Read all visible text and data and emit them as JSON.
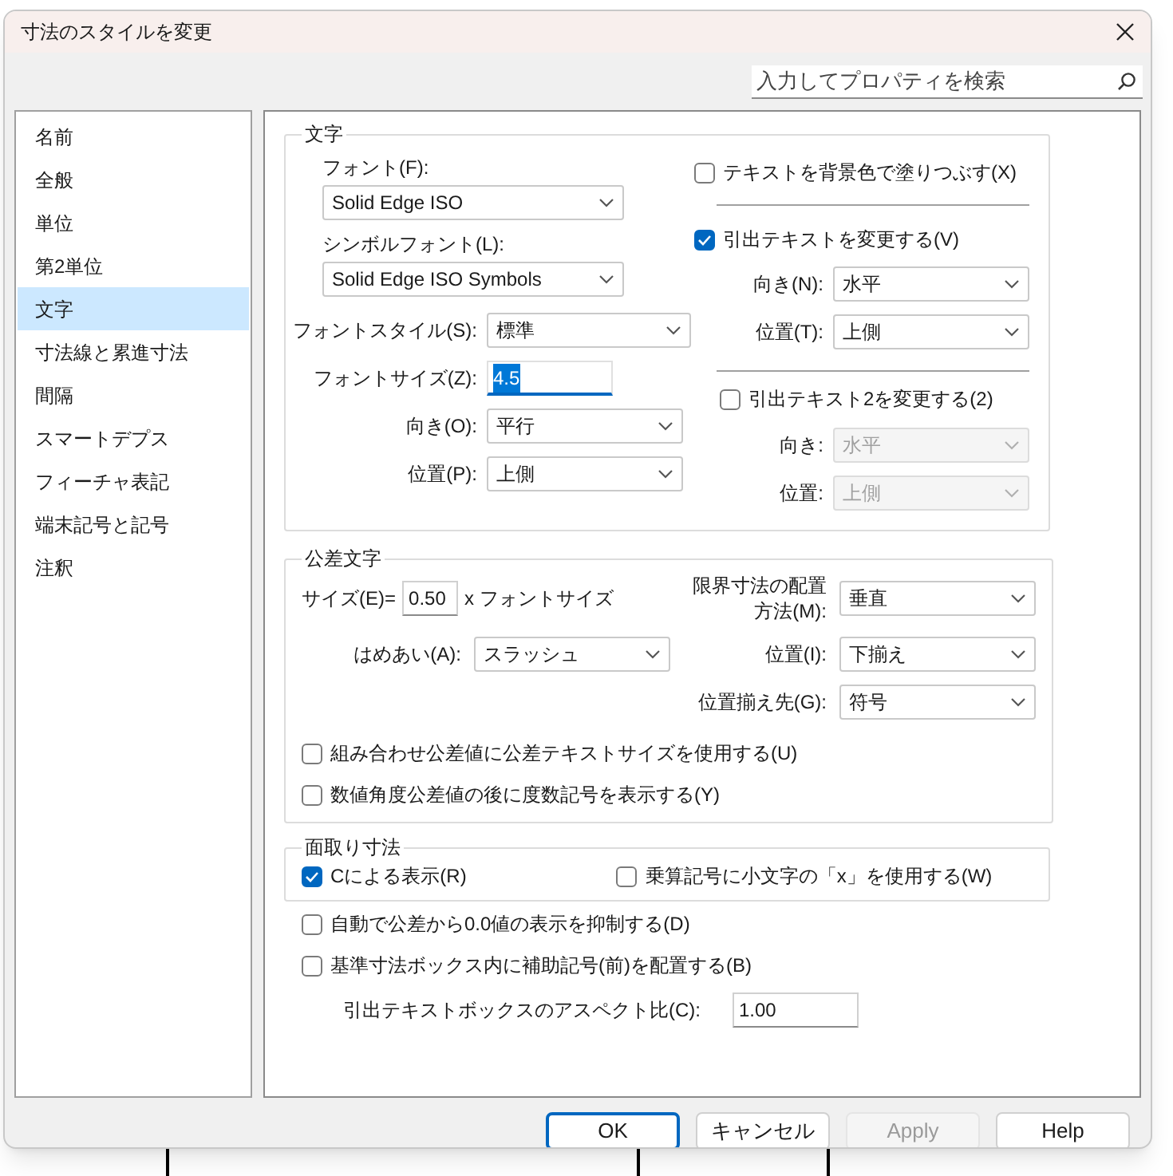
{
  "window": {
    "title": "寸法のスタイルを変更"
  },
  "search": {
    "placeholder": "入力してプロパティを検索"
  },
  "sidebar": {
    "items": [
      {
        "label": "名前",
        "selected": false
      },
      {
        "label": "全般",
        "selected": false
      },
      {
        "label": "単位",
        "selected": false
      },
      {
        "label": "第2単位",
        "selected": false
      },
      {
        "label": "文字",
        "selected": true
      },
      {
        "label": "寸法線と累進寸法",
        "selected": false
      },
      {
        "label": "間隔",
        "selected": false
      },
      {
        "label": "スマートデプス",
        "selected": false
      },
      {
        "label": "フィーチャ表記",
        "selected": false
      },
      {
        "label": "端末記号と記号",
        "selected": false
      },
      {
        "label": "注釈",
        "selected": false
      }
    ]
  },
  "text_group": {
    "title": "文字",
    "font": {
      "label": "フォント(F):",
      "value": "Solid Edge ISO"
    },
    "symbol_font": {
      "label": "シンボルフォント(L):",
      "value": "Solid Edge ISO Symbols"
    },
    "font_style": {
      "label": "フォントスタイル(S):",
      "value": "標準"
    },
    "font_size": {
      "label": "フォントサイズ(Z):",
      "value": "4.5",
      "focused": true
    },
    "orientation": {
      "label": "向き(O):",
      "value": "平行"
    },
    "position": {
      "label": "位置(P):",
      "value": "上側"
    },
    "fill_background": {
      "label": "テキストを背景色で塗りつぶす(X)",
      "checked": false
    },
    "override_leader": {
      "label": "引出テキストを変更する(V)",
      "checked": true
    },
    "leader_orientation": {
      "label": "向き(N):",
      "value": "水平",
      "disabled": false
    },
    "leader_position": {
      "label": "位置(T):",
      "value": "上側",
      "disabled": false
    },
    "override_leader2": {
      "label": "引出テキスト2を変更する(2)",
      "checked": false
    },
    "leader2_orientation": {
      "label": "向き:",
      "value": "水平",
      "disabled": true
    },
    "leader2_position": {
      "label": "位置:",
      "value": "上側",
      "disabled": true
    }
  },
  "tolerance_group": {
    "title": "公差文字",
    "size": {
      "label": "サイズ(E)=",
      "value": "0.50",
      "suffix": "x フォントサイズ"
    },
    "limit_layout": {
      "label": "限界寸法の配置方法(M):",
      "value": "垂直"
    },
    "fit": {
      "label": "はめあい(A):",
      "value": "スラッシュ"
    },
    "tolerance_position": {
      "label": "位置(I):",
      "value": "下揃え"
    },
    "align_to": {
      "label": "位置揃え先(G):",
      "value": "符号"
    },
    "checkboxes": [
      {
        "label": "組み合わせ公差値に公差テキストサイズを使用する(U)",
        "checked": false
      },
      {
        "label": "数値角度公差値の後に度数記号を表示する(Y)",
        "checked": false
      }
    ]
  },
  "chamfer_group": {
    "title": "面取り寸法",
    "checkboxes": [
      {
        "label": "Cによる表示(R)",
        "checked": true
      },
      {
        "label": "乗算記号に小文字の「x」を使用する(W)",
        "checked": false
      }
    ]
  },
  "options": [
    {
      "label": "自動で公差から0.0値の表示を抑制する(D)",
      "checked": false
    },
    {
      "label": "基準寸法ボックス内に補助記号(前)を配置する(B)",
      "checked": false
    }
  ],
  "aspect_ratio": {
    "label": "引出テキストボックスのアスペクト比(C):",
    "value": "1.00"
  },
  "buttons": [
    {
      "label": "OK",
      "default": true,
      "disabled": false
    },
    {
      "label": "キャンセル",
      "default": false,
      "disabled": false
    },
    {
      "label": "Apply",
      "default": false,
      "disabled": true
    },
    {
      "label": "Help",
      "default": false,
      "disabled": false
    }
  ]
}
